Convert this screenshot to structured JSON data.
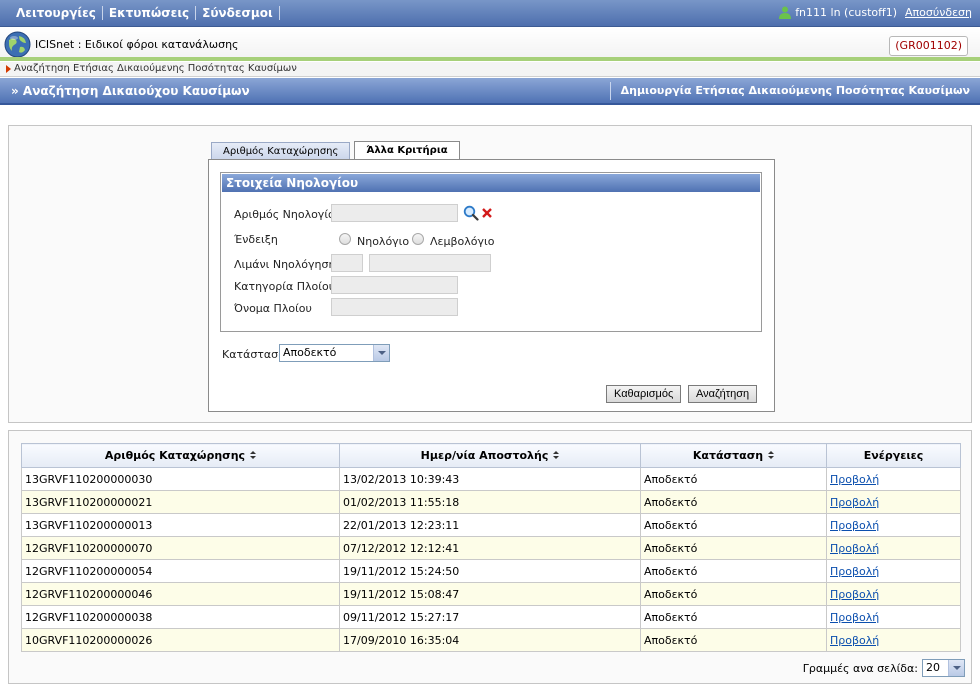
{
  "menu": [
    "Λειτουργίες",
    "Εκτυπώσεις",
    "Σύνδεσμοι"
  ],
  "user": {
    "text": "fn111 ln (custoff1)",
    "logout": "Αποσύνδεση"
  },
  "app": {
    "title": "ICISnet : Ειδικοί φόροι κατανάλωσης",
    "code": "(GR001102)"
  },
  "breadcrumb": "Αναζήτηση Ετήσιας Δικαιούμενης Ποσότητας Καυσίμων",
  "header": {
    "left": "» Αναζήτηση Δικαιούχου Καυσίμων",
    "right": "Δημιουργία Ετήσιας Δικαιούμενης Ποσότητας Καυσίμων"
  },
  "tabs": [
    "Αριθμός Καταχώρησης",
    "Άλλα Κριτήρια"
  ],
  "group": {
    "title": "Στοιχεία Νηολογίου",
    "registry_number": "Αριθμός Νηολογίου",
    "indication": "Ένδειξη",
    "radio_1": "Νηολόγιο",
    "radio_2": "Λεμβολόγιο",
    "port": "Λιμάνι Νηολόγησης",
    "category": "Κατηγορία Πλοίου",
    "name": "Όνομα Πλοίου"
  },
  "status": {
    "label": "Κατάσταση",
    "value": "Αποδεκτό"
  },
  "buttons": {
    "clear": "Καθαρισμός",
    "search": "Αναζήτηση"
  },
  "table": {
    "headers": [
      "Αριθμός Καταχώρησης",
      "Ημερ/νία Αποστολής",
      "Κατάσταση",
      "Ενέργειες"
    ],
    "rows": [
      [
        "13GRVF110200000030",
        "13/02/2013 10:39:43",
        "Αποδεκτό",
        "Προβολή"
      ],
      [
        "13GRVF110200000021",
        "01/02/2013 11:55:18",
        "Αποδεκτό",
        "Προβολή"
      ],
      [
        "13GRVF110200000013",
        "22/01/2013 12:23:11",
        "Αποδεκτό",
        "Προβολή"
      ],
      [
        "12GRVF110200000070",
        "07/12/2012 12:12:41",
        "Αποδεκτό",
        "Προβολή"
      ],
      [
        "12GRVF110200000054",
        "19/11/2012 15:24:50",
        "Αποδεκτό",
        "Προβολή"
      ],
      [
        "12GRVF110200000046",
        "19/11/2012 15:08:47",
        "Αποδεκτό",
        "Προβολή"
      ],
      [
        "12GRVF110200000038",
        "09/11/2012 15:27:17",
        "Αποδεκτό",
        "Προβολή"
      ],
      [
        "10GRVF110200000026",
        "17/09/2010 16:35:04",
        "Αποδεκτό",
        "Προβολή"
      ]
    ]
  },
  "pager": {
    "label": "Γραμμές ανα σελίδα:",
    "value": "20"
  },
  "icons": {
    "user": "user-icon",
    "globe": "globe-icon",
    "search": "search-icon",
    "clear": "clear-icon"
  }
}
